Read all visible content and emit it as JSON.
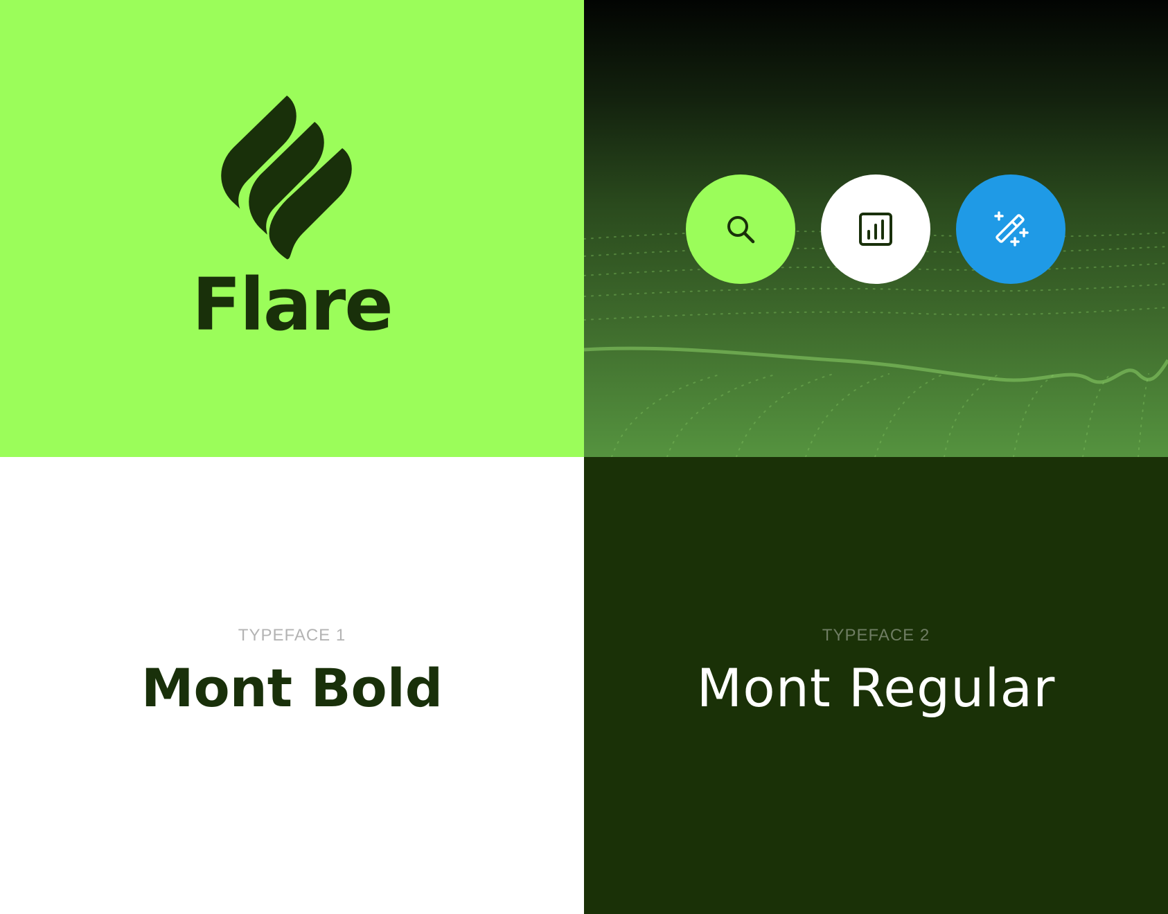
{
  "brand": {
    "name": "Flare",
    "logo_icon": "flame-leaf-logo-icon"
  },
  "icon_buttons": [
    {
      "icon": "search-icon",
      "color": "#9bfd5a"
    },
    {
      "icon": "bar-chart-icon",
      "color": "#ffffff"
    },
    {
      "icon": "magic-wand-icon",
      "color": "#1f9ae6"
    }
  ],
  "typefaces": [
    {
      "caption": "TYPEFACE 1",
      "name": "Mont Bold"
    },
    {
      "caption": "TYPEFACE 2",
      "name": "Mont Regular"
    }
  ],
  "colors": {
    "lime": "#9bfd5a",
    "dark_green": "#19300a",
    "deep_green_bg": "#1a3107",
    "blue": "#1f9ae6",
    "white": "#ffffff"
  }
}
